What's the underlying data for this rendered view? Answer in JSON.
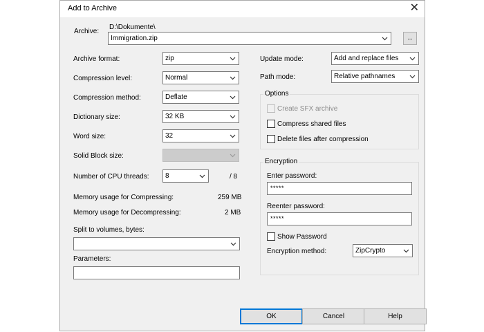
{
  "window": {
    "title": "Add to Archive",
    "close_glyph": "✕"
  },
  "archive": {
    "label": "Archive:",
    "path": "D:\\Dokumente\\",
    "filename": "Immigration.zip",
    "browse_label": "..."
  },
  "left": {
    "archive_format": {
      "label": "Archive format:",
      "value": "zip"
    },
    "compression_level": {
      "label": "Compression level:",
      "value": "Normal"
    },
    "compression_method": {
      "label": "Compression method:",
      "value": "Deflate"
    },
    "dictionary_size": {
      "label": "Dictionary size:",
      "value": "32 KB"
    },
    "word_size": {
      "label": "Word size:",
      "value": "32"
    },
    "solid_block_size": {
      "label": "Solid Block size:",
      "value": ""
    },
    "cpu_threads": {
      "label": "Number of CPU threads:",
      "value": "8",
      "max": "/ 8"
    },
    "memory_compress": {
      "label": "Memory usage for Compressing:",
      "value": "259 MB"
    },
    "memory_decompress": {
      "label": "Memory usage for Decompressing:",
      "value": "2 MB"
    },
    "split_volumes": {
      "label": "Split to volumes, bytes:",
      "value": ""
    },
    "parameters": {
      "label": "Parameters:",
      "value": ""
    }
  },
  "right": {
    "update_mode": {
      "label": "Update mode:",
      "value": "Add and replace files"
    },
    "path_mode": {
      "label": "Path mode:",
      "value": "Relative pathnames"
    },
    "options": {
      "title": "Options",
      "create_sfx": "Create SFX archive",
      "compress_shared": "Compress shared files",
      "delete_after": "Delete files after compression"
    },
    "encryption": {
      "title": "Encryption",
      "enter_password_label": "Enter password:",
      "enter_password_value": "*****",
      "reenter_password_label": "Reenter password:",
      "reenter_password_value": "*****",
      "show_password": "Show Password",
      "method_label": "Encryption method:",
      "method_value": "ZipCrypto"
    }
  },
  "buttons": {
    "ok": "OK",
    "cancel": "Cancel",
    "help": "Help"
  }
}
